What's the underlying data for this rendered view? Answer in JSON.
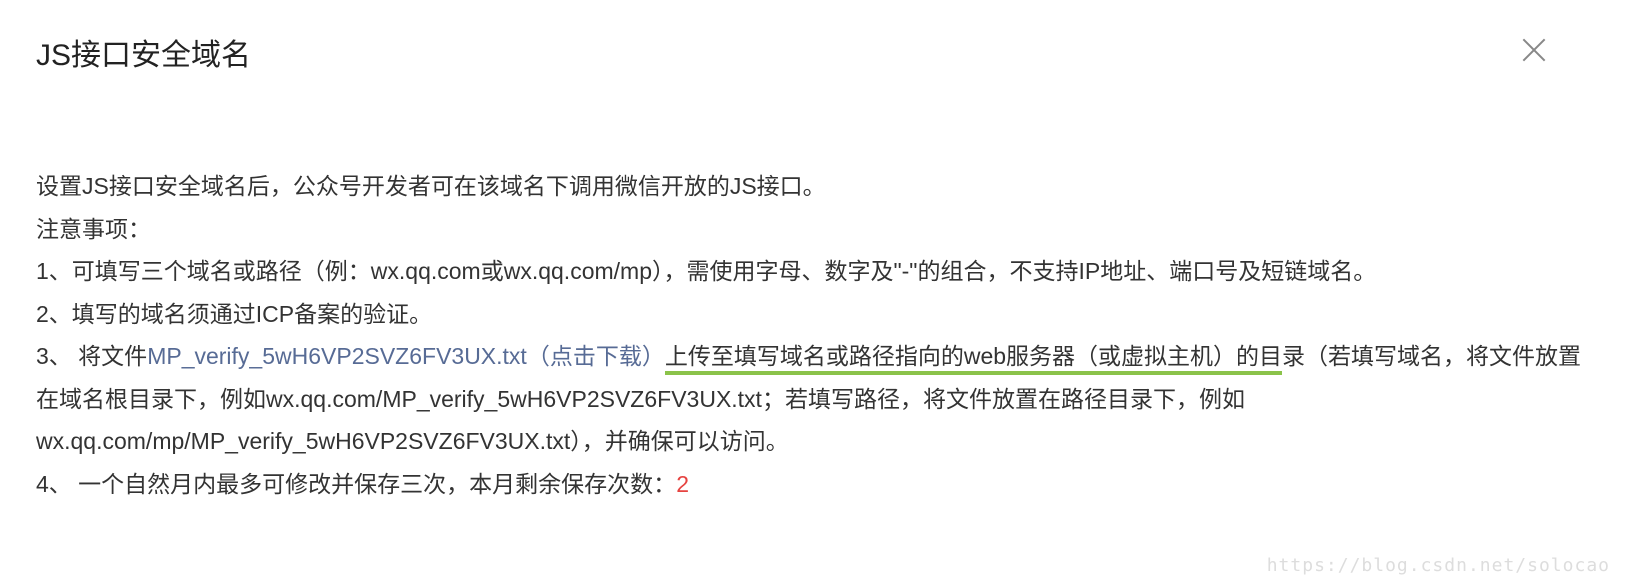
{
  "dialog": {
    "title": "JS接口安全域名",
    "intro": "设置JS接口安全域名后，公众号开发者可在该域名下调用微信开放的JS接口。",
    "notice_label": "注意事项：",
    "item1": "1、可填写三个域名或路径（例：wx.qq.com或wx.qq.com/mp），需使用字母、数字及\"-\"的组合，不支持IP地址、端口号及短链域名。",
    "item2": "2、填写的域名须通过ICP备案的验证。",
    "item3_prefix": "3、 将文件",
    "item3_link": "MP_verify_5wH6VP2SVZ6FV3UX.txt（点击下载）",
    "item3_highlight": "上传至填写域名或路径指向的web服务器（或虚拟主机）的目",
    "item3_rest": "录（若填写域名，将文件放置在域名根目录下，例如wx.qq.com/MP_verify_5wH6VP2SVZ6FV3UX.txt；若填写路径，将文件放置在路径目录下，例如wx.qq.com/mp/MP_verify_5wH6VP2SVZ6FV3UX.txt），并确保可以访问。",
    "item4_text": "4、 一个自然月内最多可修改并保存三次，本月剩余保存次数：",
    "item4_count": "2"
  },
  "watermark": "https://blog.csdn.net/solocao"
}
